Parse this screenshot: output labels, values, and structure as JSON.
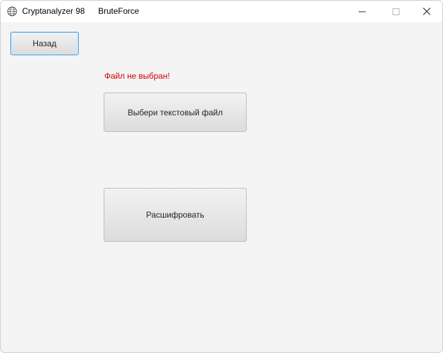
{
  "titlebar": {
    "app_title": "Cryptanalyzer 98",
    "window_title": "BruteForce",
    "app_icon": "globe-icon",
    "controls": [
      "minimize-icon",
      "maximize-icon",
      "close-icon"
    ]
  },
  "main": {
    "back_label": "Назад",
    "status_text": "Файл не выбран!",
    "choose_file_label": "Выбери текстовый файл",
    "decrypt_label": "Расшифровать"
  },
  "colors": {
    "status_error": "#d00000",
    "focus_border": "#3d9ee8",
    "window_bg": "#f4f4f4"
  }
}
